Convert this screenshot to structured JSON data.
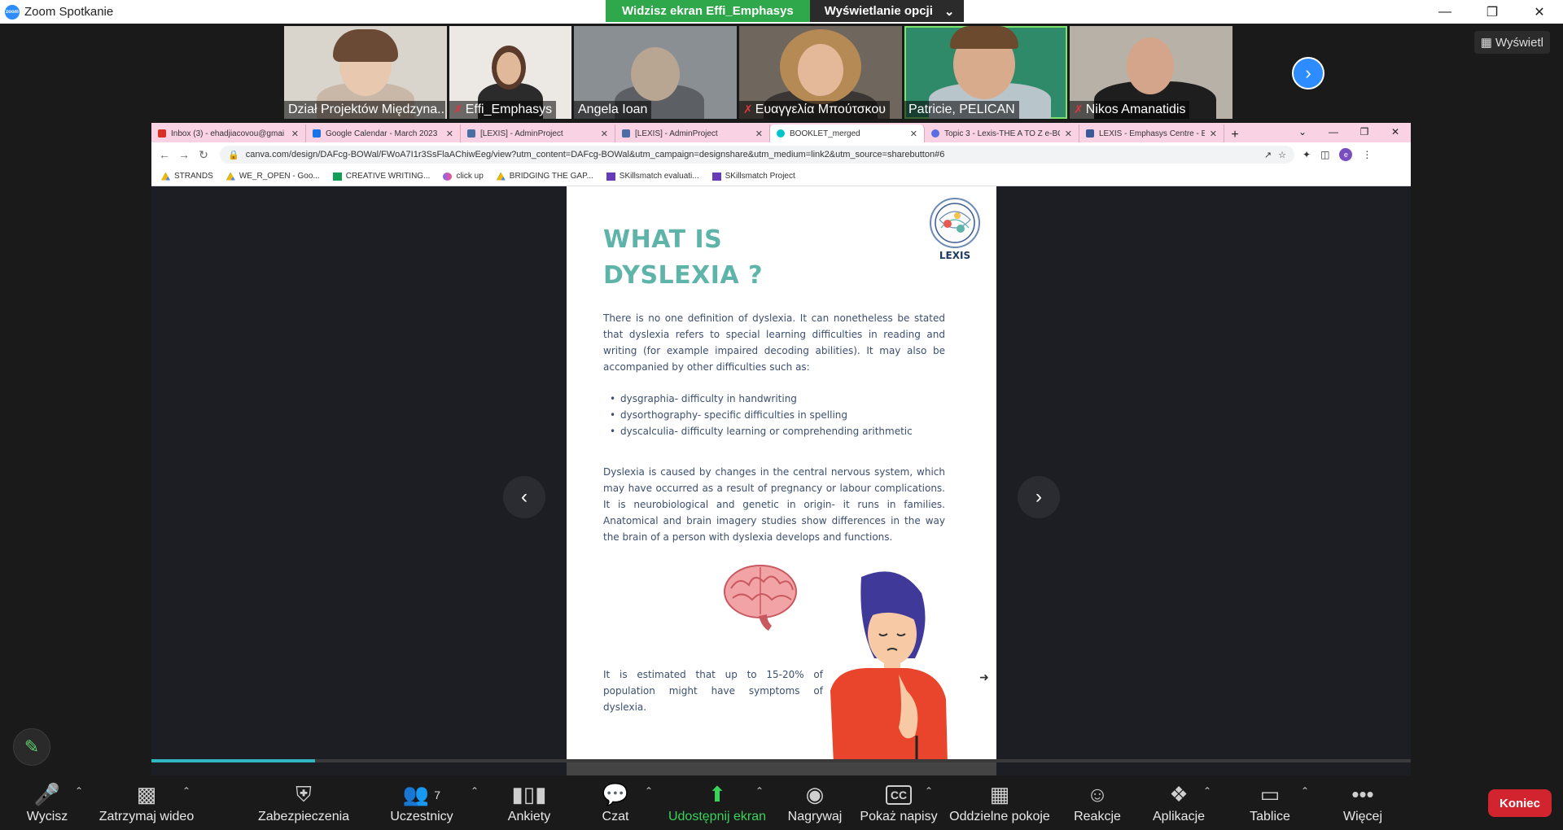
{
  "titlebar": {
    "title": "Zoom Spotkanie"
  },
  "share_banner": {
    "viewing_text": "Widzisz ekran Effi_Emphasys",
    "options_label": "Wyświetlanie opcji"
  },
  "view_button": {
    "label": "Wyświetl"
  },
  "participants": [
    {
      "name": "Dział Projektów Międzyna...",
      "muted": false,
      "active": false
    },
    {
      "name": "Effi_Emphasys",
      "muted": true,
      "active": false
    },
    {
      "name": "Angela Ioan",
      "muted": false,
      "active": false
    },
    {
      "name": "Ευαγγελία Μπούτσκου",
      "muted": true,
      "active": false
    },
    {
      "name": "Patricie, PELICAN",
      "muted": false,
      "active": true
    },
    {
      "name": "Nikos Amanatidis",
      "muted": true,
      "active": false
    }
  ],
  "browser": {
    "tabs": [
      {
        "label": "Inbox (3) - ehadjiacovou@gmai",
        "color": "#d93025"
      },
      {
        "label": "Google Calendar - March 2023",
        "color": "#1a73e8"
      },
      {
        "label": "[LEXIS] - AdminProject",
        "color": "#4a6fa5"
      },
      {
        "label": "[LEXIS] - AdminProject",
        "color": "#4a6fa5"
      },
      {
        "label": "BOOKLET_merged",
        "color": "#00c4cc"
      },
      {
        "label": "Topic 3 - Lexis-THE A TO Z e-BO",
        "color": "#5b6ee1"
      },
      {
        "label": "LEXIS - Emphasys Centre - Educ",
        "color": "#3b5998"
      }
    ],
    "url": "canva.com/design/DAFcg-BOWal/FWoA7I1r3SsFlaAChiwEeg/view?utm_content=DAFcg-BOWal&utm_campaign=designshare&utm_medium=link2&utm_source=sharebutton#6",
    "profile_initial": "e",
    "bookmarks": [
      {
        "label": "STRANDS",
        "icon": "drive-icon"
      },
      {
        "label": "WE_R_OPEN - Goo...",
        "icon": "drive-icon"
      },
      {
        "label": "CREATIVE WRITING...",
        "icon": "sheets-icon"
      },
      {
        "label": "click up",
        "icon": "clickup-icon"
      },
      {
        "label": "BRIDGING THE GAP...",
        "icon": "drive-icon"
      },
      {
        "label": "SKillsmatch evaluati...",
        "icon": "forms-icon"
      },
      {
        "label": "SKillsmatch Project",
        "icon": "forms-icon"
      }
    ],
    "progress": 0.13
  },
  "page": {
    "title": "WHAT IS DYSLEXIA ?",
    "logo_text": "LEXIS",
    "para1": "There is no one definition of dyslexia. It can nonetheless be stated that dyslexia refers to special learning difficulties in reading and writing (for example impaired decoding abilities). It may also be accompanied by other difficulties such as:",
    "bullets": [
      "dysgraphia- difficulty in handwriting",
      "dysorthography- specific difficulties in spelling",
      "dyscalculia- difficulty learning or comprehending arithmetic"
    ],
    "para2": "Dyslexia is caused by changes in the central nervous system, which may have occurred as a result of pregnancy or labour complications. It  is neurobiological and genetic in origin- it runs in families. Anatomical and brain imagery studies show differences in the way the brain of a person with dyslexia develops and functions.",
    "para3": "It is estimated that up to 15-20% of population might have symptoms of dyslexia."
  },
  "bottom_toolbar": {
    "mute": "Wycisz",
    "video": "Zatrzymaj wideo",
    "security": "Zabezpieczenia",
    "participants": "Uczestnicy",
    "participants_count": "7",
    "polls": "Ankiety",
    "chat": "Czat",
    "share": "Udostępnij ekran",
    "record": "Nagrywaj",
    "captions": "Pokaż napisy",
    "breakout": "Oddzielne pokoje",
    "reactions": "Reakcje",
    "apps": "Aplikacje",
    "whiteboards": "Tablice",
    "more": "Więcej",
    "end": "Koniec"
  },
  "colors": {
    "accent": "#2d8cff",
    "share_green": "#2ea84a",
    "end_red": "#d1242e",
    "heading_teal": "#5eb4a8"
  }
}
